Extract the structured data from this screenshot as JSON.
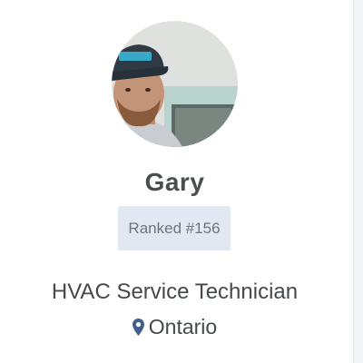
{
  "profile": {
    "name": "Gary",
    "rank": "Ranked #156",
    "job_title": "HVAC Service Technician",
    "location": "Ontario",
    "avatar_description_icon": "person-avatar-photo",
    "pin_icon": "map-pin-icon"
  },
  "colors": {
    "name_text": "#4a4d52",
    "badge_background": "#e2e8f1",
    "badge_text": "#6d7480",
    "pin": "#3f5f8f",
    "body_text": "#45484d"
  }
}
